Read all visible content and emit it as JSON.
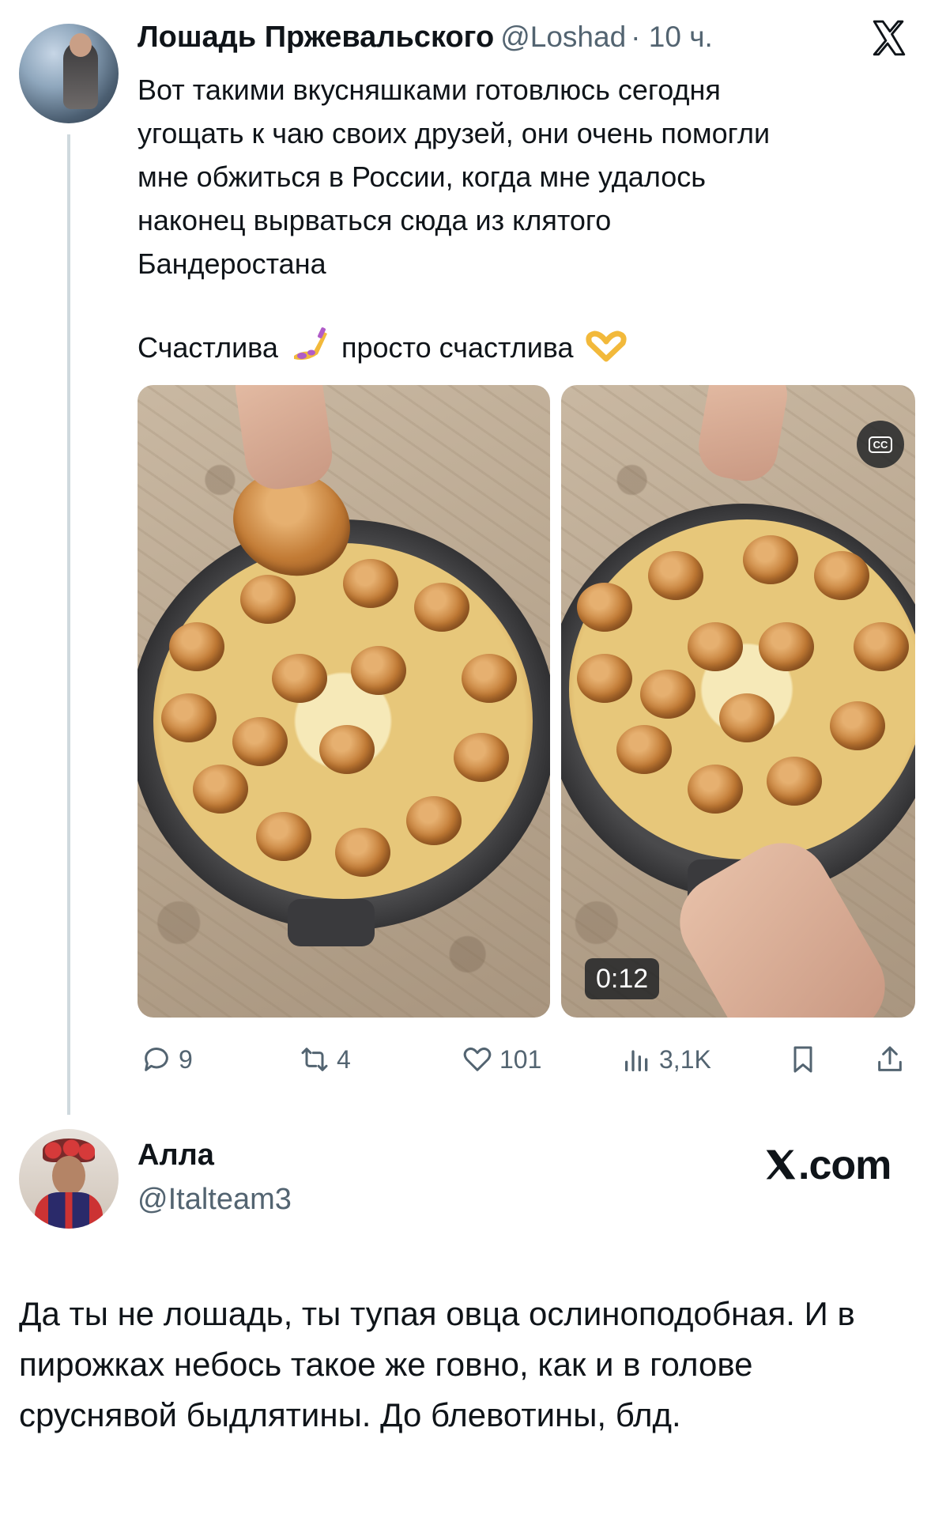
{
  "tweet": {
    "author_name": "Лошадь Пржевальского",
    "author_handle": "@Loshad",
    "time": "· 10 ч.",
    "text": "Вот такими вкусняшками готовлюсь сегодня\nугощать к чаю своих друзей, они очень помогли\nмне обжиться в России, когда мне удалось\nнаконец вырваться сюда из клятого\nБандеростана",
    "text_line2_part1": "Счастлива",
    "text_line2_part2": "просто счастлива",
    "emoji_1": "nail-polish-emoji",
    "emoji_2": "heart-hands-emoji",
    "video_duration": "0:12",
    "cc_label": "CC",
    "actions": {
      "replies": "9",
      "reposts": "4",
      "likes": "101",
      "views": "3,1K"
    }
  },
  "reply": {
    "author_name": "Алла",
    "author_handle": "@Italteam3",
    "watermark": ".com",
    "text": "Да ты не лошадь, ты тупая овца ослиноподобная. И в пирожках небось такое же говно, как и в голове сруснявой быдлятины. До блевотины, блд."
  },
  "colors": {
    "text": "#0f1419",
    "secondary": "#536471",
    "thread_line": "#cfd9de"
  }
}
